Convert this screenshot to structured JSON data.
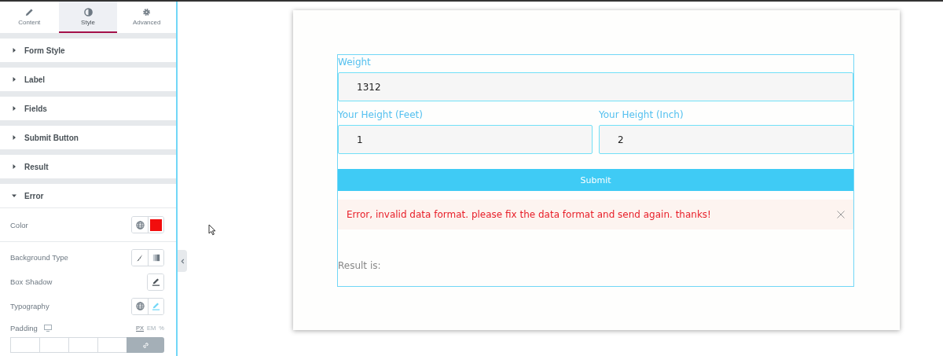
{
  "tabs": [
    {
      "label": "Content",
      "selected": false
    },
    {
      "label": "Style",
      "selected": true
    },
    {
      "label": "Advanced",
      "selected": false
    }
  ],
  "sections": [
    {
      "label": "Form Style",
      "expanded": false
    },
    {
      "label": "Label",
      "expanded": false
    },
    {
      "label": "Fields",
      "expanded": false
    },
    {
      "label": "Submit Button",
      "expanded": false
    },
    {
      "label": "Result",
      "expanded": false
    },
    {
      "label": "Error",
      "expanded": true
    }
  ],
  "controls": [
    {
      "label": "Color",
      "kind": "color",
      "color": "#f20d0d"
    },
    {
      "label": "Background Type",
      "kind": "background"
    },
    {
      "label": "Box Shadow",
      "kind": "edit"
    },
    {
      "label": "Typography",
      "kind": "typography"
    },
    {
      "label": "Padding",
      "kind": "padding",
      "units": [
        {
          "label": "PX",
          "selected": true
        },
        {
          "label": "EM",
          "selected": false
        },
        {
          "label": "%",
          "selected": false
        }
      ]
    }
  ],
  "form": {
    "rows": [
      [
        {
          "label": "Weight",
          "value": "1312"
        }
      ],
      [
        {
          "label": "Your Height (Feet)",
          "value": "1"
        },
        {
          "label": "Your Height (Inch)",
          "value": "2"
        }
      ]
    ],
    "submit": "Submit",
    "error": "Error, invalid data format. please fix the data format and send again. thanks!",
    "result": "Result is:"
  }
}
